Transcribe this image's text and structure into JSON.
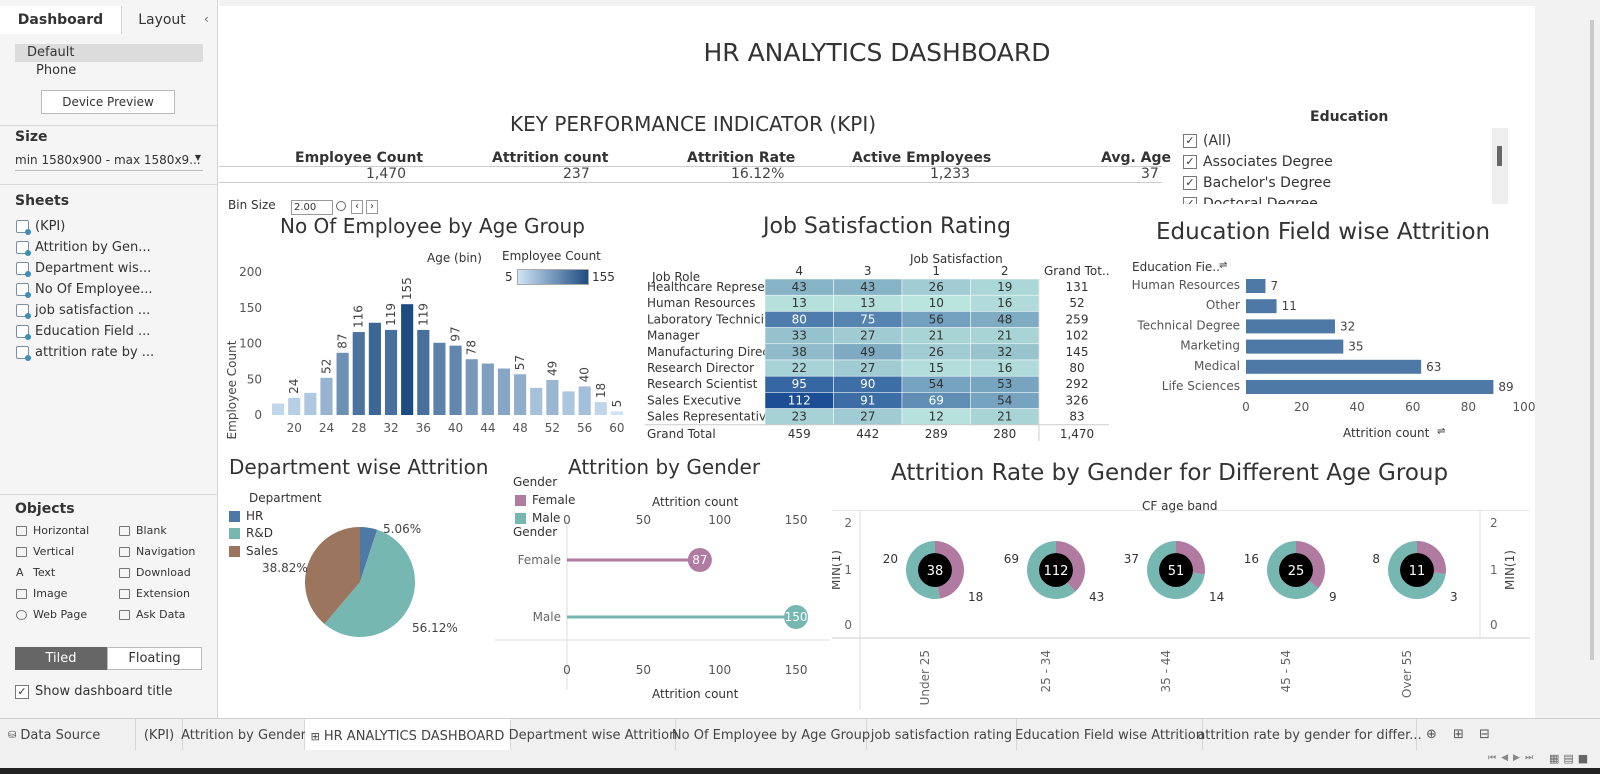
{
  "sidebar": {
    "tabs": [
      "Dashboard",
      "Layout"
    ],
    "devices": [
      "Default",
      "Phone"
    ],
    "device_preview": "Device Preview",
    "size_label": "Size",
    "size_value": "min 1580x900 - max 1580x9...",
    "sheets_label": "Sheets",
    "sheets": [
      "(KPI)",
      "Attrition by Gen...",
      "Department wis...",
      "No Of Employee...",
      "job satisfaction ...",
      "Education Field ...",
      "attrition rate by ..."
    ],
    "objects_label": "Objects",
    "objects": [
      "Horizontal",
      "Blank",
      "Vertical",
      "Navigation",
      "Text",
      "Download",
      "Image",
      "Extension",
      "Web Page",
      "Ask Data"
    ],
    "tiled": "Tiled",
    "floating": "Floating",
    "show_title": "Show dashboard title"
  },
  "dashboard": {
    "title": "HR ANALYTICS DASHBOARD",
    "kpi_title": "KEY PERFORMANCE INDICATOR (KPI)",
    "kpis": [
      {
        "label": "Employee Count",
        "value": "1,470"
      },
      {
        "label": "Attrition count",
        "value": "237"
      },
      {
        "label": "Attrition Rate",
        "value": "16.12%"
      },
      {
        "label": "Active Employees",
        "value": "1,233"
      },
      {
        "label": "Avg. Age",
        "value": "37"
      }
    ],
    "education_filter": {
      "title": "Education",
      "items": [
        "(All)",
        "Associates Degree",
        "Bachelor's Degree",
        "Doctoral Degree"
      ]
    },
    "bin_size_label": "Bin Size",
    "bin_size_value": "2.00"
  },
  "chart_data": [
    {
      "type": "bar",
      "title": "No Of Employee by Age Group",
      "xlabel": "Age (bin)",
      "ylabel": "Employee Count",
      "legend_title": "Employee Count",
      "legend_min": "5",
      "legend_max": "155",
      "x_ticks": [
        "20",
        "24",
        "28",
        "32",
        "36",
        "40",
        "44",
        "48",
        "52",
        "56",
        "60"
      ],
      "y_ticks": [
        "0",
        "50",
        "100",
        "150",
        "200"
      ],
      "ylim": [
        0,
        200
      ],
      "categories": [
        18,
        20,
        22,
        24,
        26,
        28,
        30,
        32,
        34,
        36,
        38,
        40,
        42,
        44,
        46,
        48,
        50,
        52,
        54,
        56,
        58,
        60
      ],
      "values": [
        16,
        24,
        31,
        52,
        87,
        116,
        129,
        119,
        155,
        119,
        101,
        97,
        78,
        72,
        65,
        57,
        38,
        49,
        33,
        40,
        18,
        5
      ],
      "labels": [
        "",
        "24",
        "",
        "52",
        "87",
        "116",
        "",
        "119",
        "155",
        "119",
        "",
        "97",
        "78",
        "",
        "",
        "57",
        "",
        "49",
        "",
        "40",
        "18",
        "5"
      ]
    },
    {
      "type": "heatmap",
      "title": "Job Satisfaction  Rating",
      "column_header": "Job Satisfaction",
      "row_header": "Job Role",
      "columns": [
        "4",
        "3",
        "1",
        "2"
      ],
      "grand_total_label": "Grand Tot..",
      "rows": [
        {
          "role": "Healthcare Represe..",
          "values": [
            43,
            43,
            26,
            19
          ],
          "total": "131"
        },
        {
          "role": "Human Resources",
          "values": [
            13,
            13,
            10,
            16
          ],
          "total": "52"
        },
        {
          "role": "Laboratory Technici..",
          "values": [
            80,
            75,
            56,
            48
          ],
          "total": "259"
        },
        {
          "role": "Manager",
          "values": [
            33,
            27,
            21,
            21
          ],
          "total": "102"
        },
        {
          "role": "Manufacturing Direc..",
          "values": [
            38,
            49,
            26,
            32
          ],
          "total": "145"
        },
        {
          "role": "Research Director",
          "values": [
            22,
            27,
            15,
            16
          ],
          "total": "80"
        },
        {
          "role": "Research Scientist",
          "values": [
            95,
            90,
            54,
            53
          ],
          "total": "292"
        },
        {
          "role": "Sales Executive",
          "values": [
            112,
            91,
            69,
            54
          ],
          "total": "326"
        },
        {
          "role": "Sales Representative",
          "values": [
            23,
            27,
            12,
            21
          ],
          "total": "83"
        }
      ],
      "grand_total_row": {
        "label": "Grand Total",
        "values": [
          "459",
          "442",
          "289",
          "280"
        ],
        "total": "1,470"
      }
    },
    {
      "type": "bar",
      "title": "Education Field wise Attrition",
      "row_header": "Education Fie..",
      "xlabel": "Attrition count",
      "x_ticks": [
        "0",
        "20",
        "40",
        "60",
        "80",
        "100"
      ],
      "xlim": [
        0,
        100
      ],
      "categories": [
        "Human Resources",
        "Other",
        "Technical Degree",
        "Marketing",
        "Medical",
        "Life Sciences"
      ],
      "values": [
        7,
        11,
        32,
        35,
        63,
        89
      ]
    },
    {
      "type": "pie",
      "title": "Department wise Attrition",
      "legend_title": "Department",
      "slices": [
        {
          "name": "HR",
          "value": 5.06,
          "label": "5.06%",
          "color": "#4e79a7"
        },
        {
          "name": "R&D",
          "value": 56.12,
          "label": "56.12%",
          "color": "#76b7b2"
        },
        {
          "name": "Sales",
          "value": 38.82,
          "label": "38.82%",
          "color": "#9c755f"
        }
      ]
    },
    {
      "type": "bar",
      "title": "Attrition by Gender",
      "legend_title": "Gender",
      "row_header": "Gender",
      "xlabel": "Attrition count",
      "x_ticks": [
        "0",
        "50",
        "100",
        "150"
      ],
      "xlim": [
        0,
        165
      ],
      "categories": [
        "Female",
        "Male"
      ],
      "values": [
        87,
        150
      ],
      "colors": [
        "#b07aa1",
        "#76b7b2"
      ]
    },
    {
      "type": "pie",
      "title": "Attrition Rate by Gender for Different Age Group",
      "column_header": "CF age band",
      "ylabel": "MIN(1)",
      "y_ticks": [
        "0",
        "1",
        "2"
      ],
      "groups": [
        {
          "band": "Under 25",
          "total": 38,
          "male": 20,
          "female": 18
        },
        {
          "band": "25 - 34",
          "total": 112,
          "male": 69,
          "female": 43
        },
        {
          "band": "35 - 44",
          "total": 51,
          "male": 37,
          "female": 14
        },
        {
          "band": "45 - 54",
          "total": 25,
          "male": 16,
          "female": 9
        },
        {
          "band": "Over 55",
          "total": 11,
          "male": 8,
          "female": 3
        }
      ],
      "colors": {
        "female": "#b07aa1",
        "male": "#76b7b2"
      }
    }
  ],
  "bottom_tabs": [
    "Data Source",
    "(KPI)",
    "Attrition by Gender",
    "HR ANALYTICS DASHBOARD",
    "Department wise Attrition",
    "No Of Employee by Age Group",
    "job satisfaction rating",
    "Education Field wise Attrition",
    "attrition rate by gender for differ..."
  ]
}
